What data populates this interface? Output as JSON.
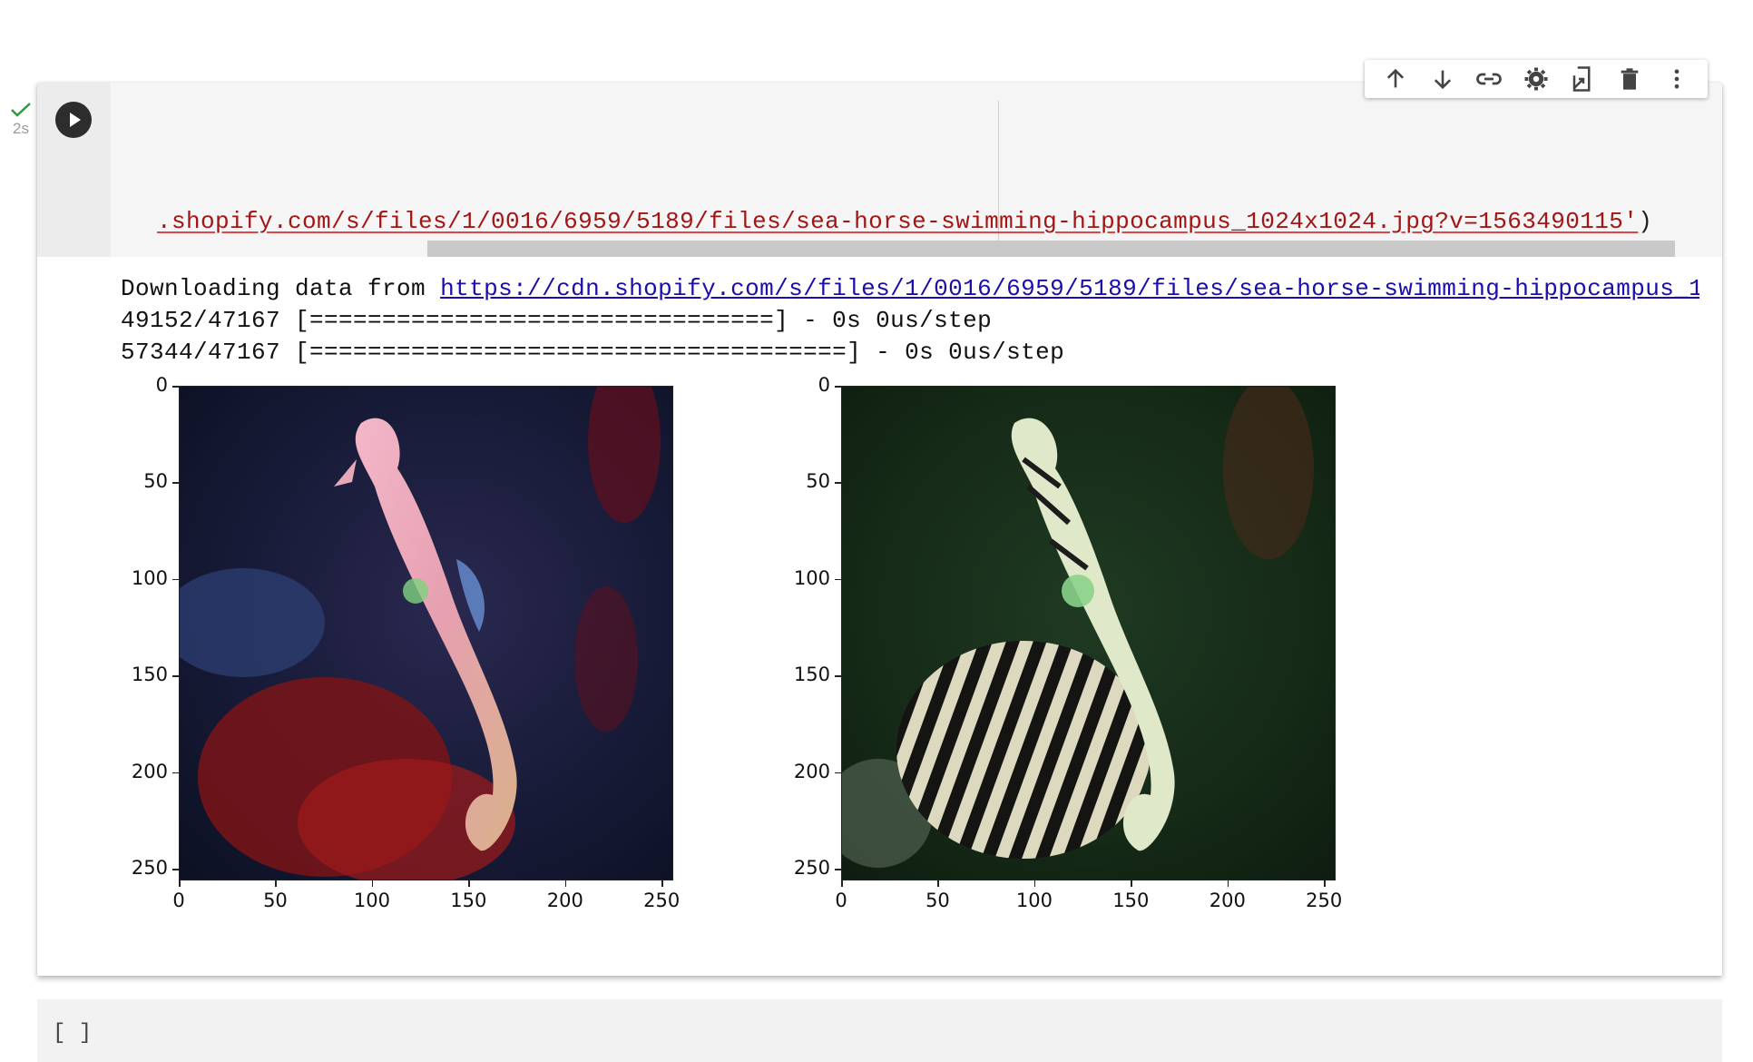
{
  "cell": {
    "status_duration": "2s",
    "code_text_prefix": ".shopify.com/s/files/1/0016/6959/5189/files/sea-horse-swimming-hippocampus_1024x1024.jpg?v=1563490115'",
    "code_text_suffix": ")",
    "toolbar": [
      "arrow-up-icon",
      "arrow-down-icon",
      "link-icon",
      "gear-icon",
      "mirror-icon",
      "trash-icon",
      "more-vert-icon"
    ]
  },
  "output": {
    "download_prefix": "Downloading data from ",
    "download_url": "https://cdn.shopify.com/s/files/1/0016/6959/5189/files/sea-horse-swimming-hippocampus_1024x1024.jpg?v=1563490115",
    "progress_1": "49152/47167 [================================] - 0s 0us/step",
    "progress_2": "57344/47167 [=====================================] - 0s 0us/step"
  },
  "plots": {
    "left": {
      "description_icon": "seahorse-image"
    },
    "right": {
      "description_icon": "zebra-seahorse-image"
    },
    "y_ticks": [
      "0",
      "50",
      "100",
      "150",
      "200",
      "250"
    ],
    "x_ticks": [
      "0",
      "50",
      "100",
      "150",
      "200",
      "250"
    ]
  },
  "next_cell": {
    "bracket": "[ ]"
  }
}
